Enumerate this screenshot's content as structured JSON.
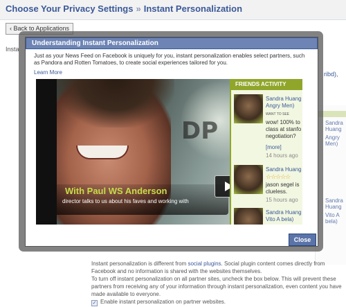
{
  "header": {
    "crumb_1": "Choose Your Privacy Settings",
    "separator": "»",
    "crumb_2": "Instant Personalization"
  },
  "back_button": "‹ Back to Applications",
  "background": {
    "left_fragment": "Insta",
    "right_fragment": "ribd),",
    "widget": {
      "name_1": "Sandra Huang",
      "sub_1": "Angry Men)",
      "name_2": "Sandra Huang",
      "sub_2": "Vito A bela)"
    },
    "para_1_before": "Instant personalization is different from ",
    "para_1_link": "social plugins",
    "para_1_after": ". Social plugin content comes directly from Facebook and no information is shared with the websites themselves.",
    "para_2": "To turn off instant personalization on all partner sites, uncheck the box below. This will prevent these partners from receiving any of your information through instant personalization, even content you have made available to everyone.",
    "checkbox_label": "Enable instant personalization on partner websites."
  },
  "dialog": {
    "title": "Understanding Instant Personalization",
    "body": "Just as your News Feed on Facebook is uniquely for you, instant personalization enables select partners, such as Pandora and Rotten Tomatoes, to create social experiences tailored for you.",
    "learn_more": "Learn More",
    "close": "Close"
  },
  "video": {
    "title": "With Paul WS Anderson",
    "subtitle": "director talks to us about his faves and working with",
    "logo": "DP",
    "friends_heading": "FRIENDS ACTIVITY",
    "friends": [
      {
        "name": "Sandra Huang",
        "sub": "Angry Men)",
        "want": "WANT TO SEE",
        "text": "wow! 100% to class at stanfo negotiation?",
        "more": "[more]",
        "ago": "14 hours ago"
      },
      {
        "name": "Sandra Huang",
        "stars": "☆☆☆☆☆",
        "text": "jason segel is clueless.",
        "ago": "15 hours ago"
      },
      {
        "name": "Sandra Huang",
        "sub": "Vito A bela)"
      }
    ]
  }
}
